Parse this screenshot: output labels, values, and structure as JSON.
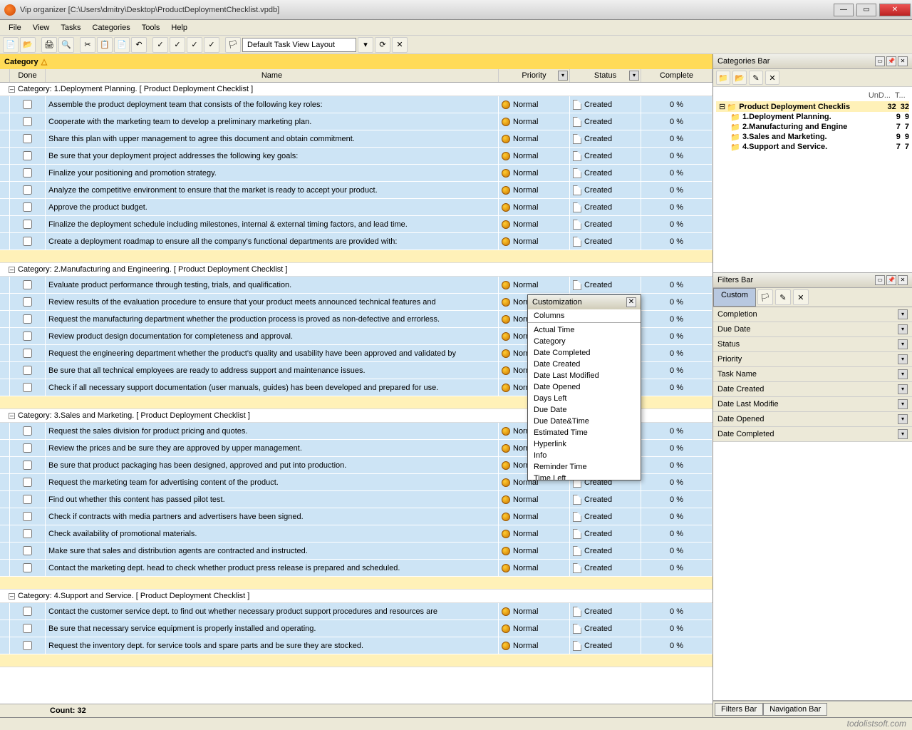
{
  "window": {
    "title": "Vip organizer [C:\\Users\\dmitry\\Desktop\\ProductDeploymentChecklist.vpdb]"
  },
  "menu": [
    "File",
    "View",
    "Tasks",
    "Categories",
    "Tools",
    "Help"
  ],
  "layout_selector": "Default Task View Layout",
  "groupbar": "Category",
  "columns": {
    "done": "Done",
    "name": "Name",
    "priority": "Priority",
    "status": "Status",
    "complete": "Complete"
  },
  "defaults": {
    "priority": "Normal",
    "status": "Created",
    "complete": "0 %"
  },
  "categories": [
    {
      "label": "Category: 1.Deployment Planning.    [ Product Deployment Checklist ]",
      "tasks": [
        {
          "name": "Assemble the product deployment team that consists of the following key roles:"
        },
        {
          "name": "Cooperate with the marketing team to develop a preliminary marketing plan."
        },
        {
          "name": "Share this plan with upper management to agree this document and obtain commitment."
        },
        {
          "name": "Be sure that your deployment project addresses the following key goals:"
        },
        {
          "name": "Finalize your positioning and promotion strategy."
        },
        {
          "name": "Analyze the competitive environment to ensure that the market is ready to accept your product."
        },
        {
          "name": "Approve the product budget."
        },
        {
          "name": "Finalize the deployment schedule including milestones, internal & external timing factors, and lead time."
        },
        {
          "name": "Create a deployment roadmap to ensure all the company's functional departments are provided with:"
        }
      ]
    },
    {
      "label": "Category: 2.Manufacturing and Engineering.    [ Product Deployment Checklist ]",
      "tasks": [
        {
          "name": "Evaluate product performance through testing, trials, and qualification."
        },
        {
          "name": "Review results of the evaluation procedure to ensure that your product meets announced technical features and"
        },
        {
          "name": "Request the manufacturing department whether the production process is proved as non-defective and errorless."
        },
        {
          "name": "Review product design documentation for completeness and approval."
        },
        {
          "name": "Request the engineering department whether the product's quality and usability have been approved and validated by"
        },
        {
          "name": "Be sure that all technical employees are ready to address support and maintenance issues."
        },
        {
          "name": "Check if all necessary support documentation (user manuals, guides) has been developed and prepared for use."
        }
      ]
    },
    {
      "label": "Category: 3.Sales and Marketing.    [ Product Deployment Checklist ]",
      "tasks": [
        {
          "name": "Request the sales division for product pricing and quotes."
        },
        {
          "name": "Review the prices and be sure they are approved by upper management."
        },
        {
          "name": "Be sure that product packaging has been designed, approved and put into production."
        },
        {
          "name": "Request the marketing team for advertising content of the product."
        },
        {
          "name": "Find out whether this content has passed pilot test."
        },
        {
          "name": "Check if contracts with media partners and advertisers have been signed."
        },
        {
          "name": "Check availability of promotional materials."
        },
        {
          "name": "Make sure that sales and distribution agents are contracted and instructed."
        },
        {
          "name": "Contact the marketing dept. head to check whether product press release is prepared and scheduled."
        }
      ]
    },
    {
      "label": "Category: 4.Support and Service.    [ Product Deployment Checklist ]",
      "tasks": [
        {
          "name": "Contact the customer service dept. to find out whether necessary product support procedures and resources are"
        },
        {
          "name": "Be sure that necessary service equipment is properly installed and operating."
        },
        {
          "name": "Request the inventory dept. for service tools and spare parts and be sure they are stocked."
        }
      ]
    }
  ],
  "footer": "Count:  32",
  "sidebar": {
    "cat_panel": {
      "title": "Categories Bar",
      "cols": [
        "UnD...",
        "T..."
      ],
      "tree": [
        {
          "indent": 0,
          "label": "Product Deployment Checklis",
          "n1": "32",
          "n2": "32",
          "bold": true,
          "sel": true
        },
        {
          "indent": 1,
          "label": "1.Deployment Planning.",
          "n1": "9",
          "n2": "9",
          "bold": true
        },
        {
          "indent": 1,
          "label": "2.Manufacturing and Engine",
          "n1": "7",
          "n2": "7",
          "bold": true
        },
        {
          "indent": 1,
          "label": "3.Sales and Marketing.",
          "n1": "9",
          "n2": "9",
          "bold": true
        },
        {
          "indent": 1,
          "label": "4.Support and Service.",
          "n1": "7",
          "n2": "7",
          "bold": true
        }
      ]
    },
    "filter_panel": {
      "title": "Filters Bar",
      "tab": "Custom",
      "rows": [
        "Completion",
        "Due Date",
        "Status",
        "Priority",
        "Task Name",
        "Date Created",
        "Date Last Modifie",
        "Date Opened",
        "Date Completed"
      ]
    },
    "bottom_tabs": [
      "Filters Bar",
      "Navigation Bar"
    ]
  },
  "customization": {
    "title": "Customization",
    "tab": "Columns",
    "items": [
      "Actual Time",
      "Category",
      "Date Completed",
      "Date Created",
      "Date Last Modified",
      "Date Opened",
      "Days Left",
      "Due Date",
      "Due Date&Time",
      "Estimated Time",
      "Hyperlink",
      "Info",
      "Reminder Time",
      "Time Left"
    ]
  },
  "watermark": "todolistsoft.com"
}
